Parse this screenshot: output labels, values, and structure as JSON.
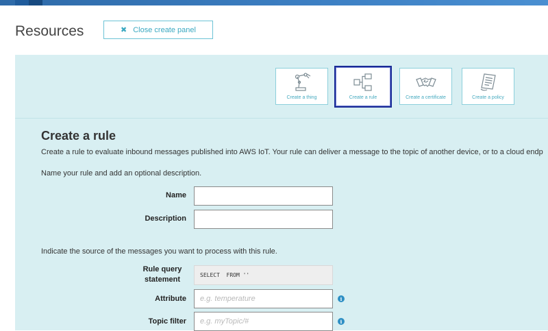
{
  "page": {
    "title": "Resources",
    "close_button_label": "Close create panel"
  },
  "tiles": [
    {
      "label": "Create a thing",
      "icon": "robot-arm-icon"
    },
    {
      "label": "Create a rule",
      "icon": "rule-flow-icon",
      "selected": true
    },
    {
      "label": "Create a certificate",
      "icon": "handshake-icon"
    },
    {
      "label": "Create a policy",
      "icon": "document-policy-icon"
    }
  ],
  "form": {
    "title": "Create a rule",
    "intro": "Create a rule to evaluate inbound messages published into AWS IoT. Your rule can deliver a message to the topic of another device, or to a cloud endp",
    "name_prompt": "Name your rule and add an optional description.",
    "name_label": "Name",
    "name_value": "",
    "description_label": "Description",
    "description_value": "",
    "source_prompt": "Indicate the source of the messages you want to process with this rule.",
    "query_label": "Rule query statement",
    "query_value": "SELECT  FROM ''",
    "attribute_label": "Attribute",
    "attribute_placeholder": "e.g. temperature",
    "topic_label": "Topic filter",
    "topic_placeholder": "e.g. myTopic/#"
  },
  "colors": {
    "panel_bg": "#d8eff2",
    "accent": "#3aa8c1",
    "selected_border": "#1a2b96",
    "info_icon": "#2e8fc4"
  }
}
